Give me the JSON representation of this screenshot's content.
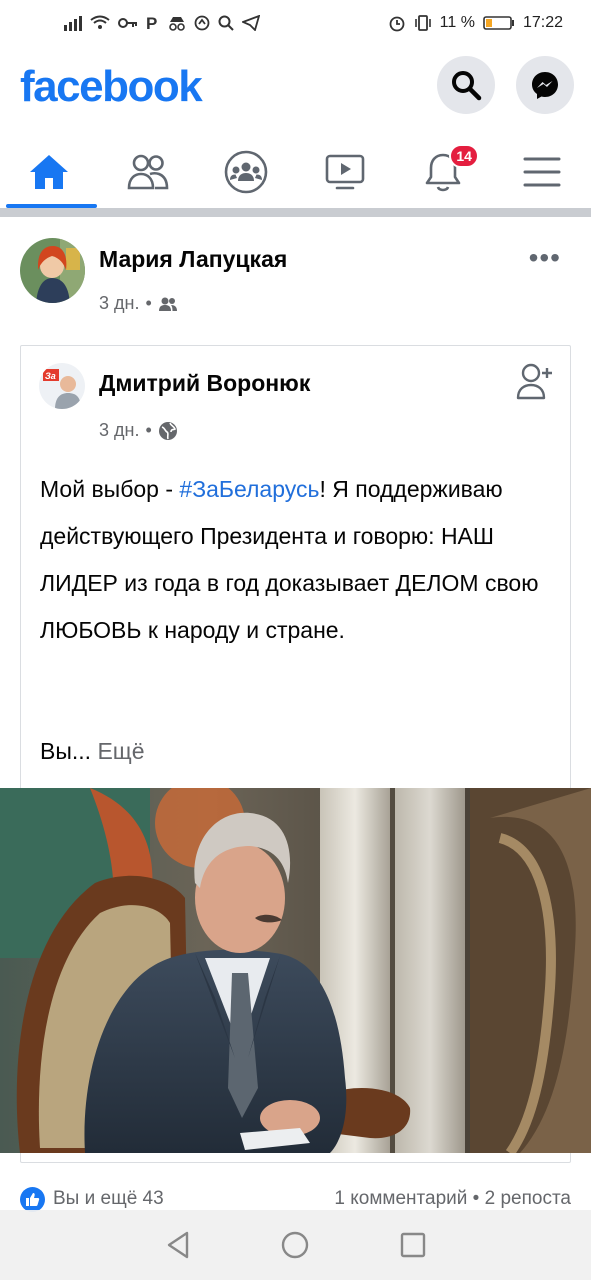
{
  "status_bar": {
    "battery_text": "11 %",
    "time": "17:22"
  },
  "header": {
    "logo": "facebook",
    "search_icon": "search-icon",
    "messenger_icon": "messenger-icon"
  },
  "nav": {
    "tabs": [
      {
        "icon": "home-icon",
        "active": true
      },
      {
        "icon": "friends-icon",
        "active": false
      },
      {
        "icon": "groups-icon",
        "active": false
      },
      {
        "icon": "watch-icon",
        "active": false
      },
      {
        "icon": "bell-icon",
        "active": false,
        "badge": "14"
      },
      {
        "icon": "menu-icon",
        "active": false
      }
    ]
  },
  "post": {
    "author": "Мария Лапуцкая",
    "time": "3 дн.",
    "audience_icon": "friends-icon",
    "shared": {
      "author": "Дмитрий Воронюк",
      "time": "3 дн.",
      "audience_icon": "globe-icon",
      "text_before": "Мой выбор - ",
      "hashtag": "#ЗаБеларусь",
      "text_after": "! Я поддерживаю действующего Президента и говорю: НАШ ЛИДЕР из года в год доказывает ДЕЛОМ свою ЛЮБОВЬ к народу и стране.",
      "truncated": "Вы...",
      "more": "Ещё"
    },
    "reactions": {
      "likes": "Вы и ещё 43",
      "comments_shares": "1 комментарий • 2 репоста"
    }
  },
  "colors": {
    "brand": "#1877f2",
    "badge": "#e41e3f",
    "hashtag": "#216fdb"
  }
}
